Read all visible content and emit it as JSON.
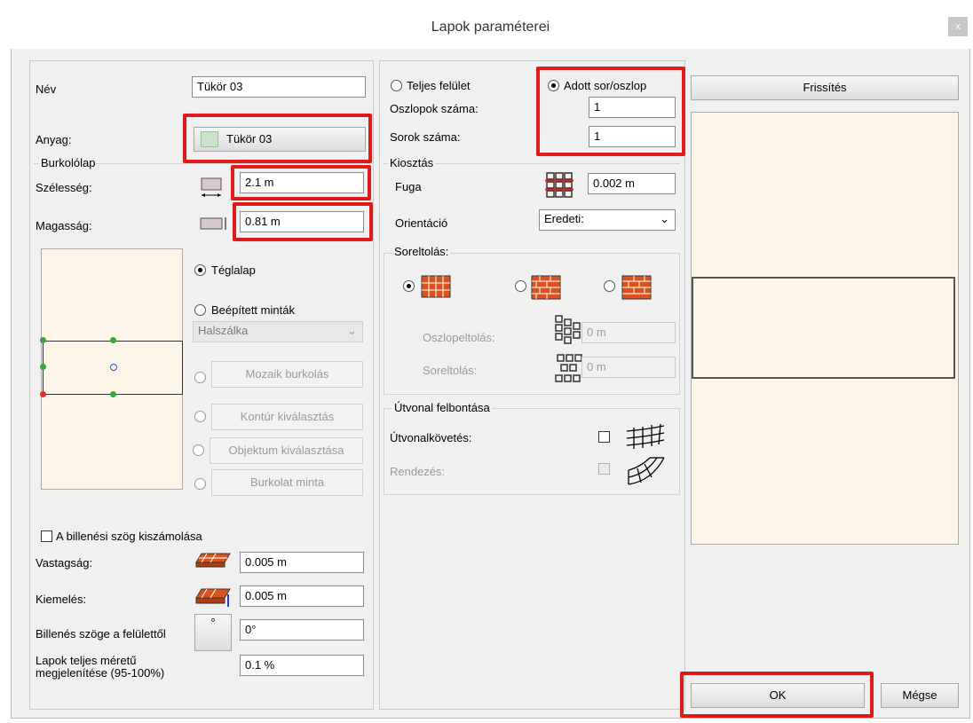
{
  "window": {
    "title": "Lapok paraméterei",
    "close_symbol": "x"
  },
  "left": {
    "nev_label": "Név",
    "nev_value": "Tükör 03",
    "anyag_label": "Anyag:",
    "anyag_button": "Tükör 03",
    "burkololap_group": "Burkolólap",
    "szelesseg_label": "Szélesség:",
    "szelesseg_value": "2.1 m",
    "magassag_label": "Magasság:",
    "magassag_value": "0.81 m",
    "teglalap_label": "Téglalap",
    "beepitett_label": "Beépített minták",
    "halszalka_value": "Halszálka",
    "mozaik_button": "Mozaik burkolás",
    "kontur_button": "Kontúr kiválasztás",
    "objektum_button": "Objektum kiválasztása",
    "burkolat_button": "Burkolat minta",
    "billenesi_checkbox": "A billenési szög kiszámolása",
    "vastagsag_label": "Vastagság:",
    "vastagsag_value": "0.005 m",
    "kiemeles_label": "Kiemelés:",
    "kiemeles_value": "0.005 m",
    "billenes_label": "Billenés szöge a felülettől",
    "billenes_button": "°",
    "billenes_value": "0°",
    "lapok_label_1": "Lapok teljes méretű",
    "lapok_label_2": "megjelenítése (95-100%)",
    "lapok_value": "0.1 %"
  },
  "middle": {
    "teljes_label": "Teljes felület",
    "adott_label": "Adott sor/oszlop",
    "oszlopok_label": "Oszlopok száma:",
    "oszlopok_value": "1",
    "sorok_label": "Sorok száma:",
    "sorok_value": "1",
    "kiosztas_group": "Kiosztás",
    "fuga_label": "Fuga",
    "fuga_value": "0.002 m",
    "orientacio_label": "Orientáció",
    "orientacio_value": "Eredeti:",
    "soreltolas_group": "Soreltolás:",
    "oszlopeltolas_label": "Oszlopeltolás:",
    "oszlopeltolas_value": "0 m",
    "soreltolas_label": "Soreltolás:",
    "soreltolas_value": "0 m",
    "utvonal_group": "Útvonal felbontása",
    "utvonalkovetes_label": "Útvonalkövetés:",
    "rendezes_label": "Rendezés:"
  },
  "right": {
    "frissites_button": "Frissítés",
    "ok_button": "OK",
    "megse_button": "Mégse"
  },
  "colors": {
    "highlight": "#e01a1a",
    "preview_bg": "#fdf6e8",
    "brick": "#d9531e"
  }
}
